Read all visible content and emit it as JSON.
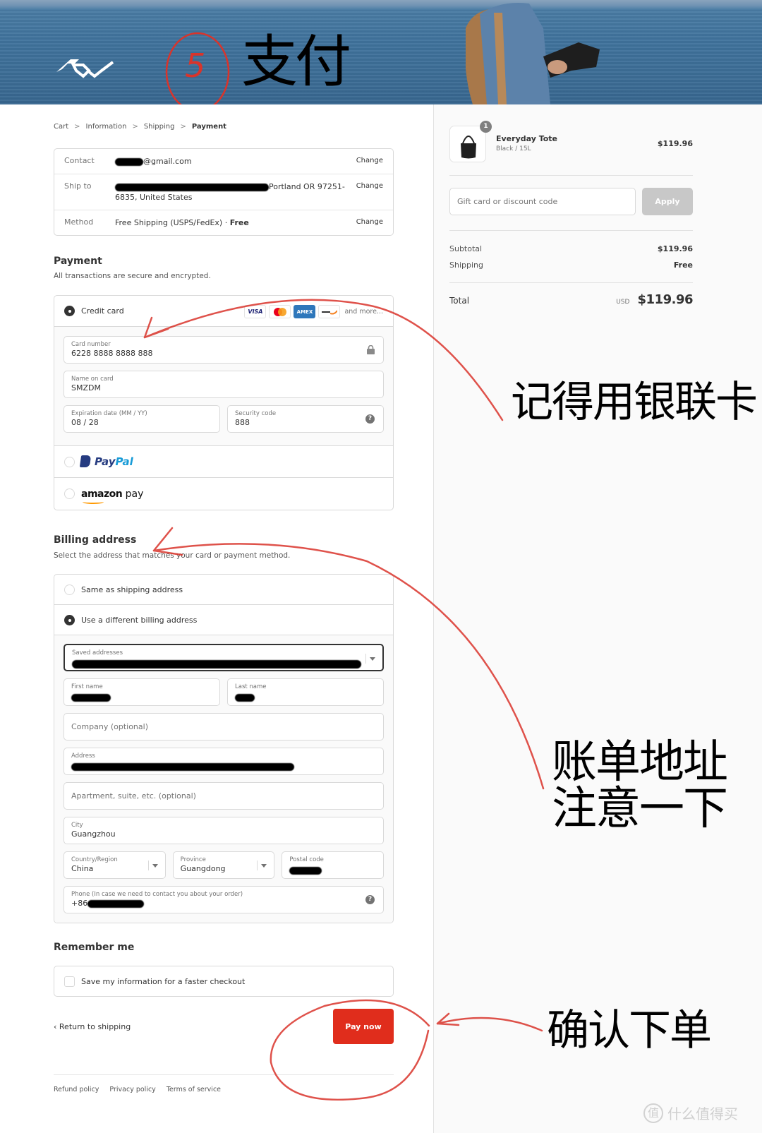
{
  "banner": {
    "brand_logo": "peak-design-logo",
    "annotation_step": "5",
    "annotation_title": "支付"
  },
  "breadcrumb": [
    {
      "label": "Cart"
    },
    {
      "label": "Information"
    },
    {
      "label": "Shipping"
    },
    {
      "label": "Payment",
      "current": true
    }
  ],
  "review": {
    "contact": {
      "label": "Contact",
      "value": "@gmail.com",
      "change": "Change"
    },
    "ship_to": {
      "label": "Ship to",
      "value": "Portland OR 97251-6835, United States",
      "change": "Change"
    },
    "method": {
      "label": "Method",
      "value": "Free Shipping (USPS/FedEx) · ",
      "value_bold": "Free",
      "change": "Change"
    }
  },
  "payment": {
    "title": "Payment",
    "subtitle": "All transactions are secure and encrypted.",
    "credit_card_label": "Credit card",
    "brands": [
      "VISA",
      "mastercard",
      "AMEX",
      "discover"
    ],
    "and_more": "and more...",
    "card_number": {
      "label": "Card number",
      "value": "6228 8888 8888 888"
    },
    "name_on_card": {
      "label": "Name on card",
      "value": "SMZDM"
    },
    "expiration": {
      "label": "Expiration date (MM / YY)",
      "value": "08 / 28"
    },
    "security_code": {
      "label": "Security code",
      "value": "888"
    },
    "paypal": {
      "pay": "Pay",
      "pal": "Pal"
    },
    "amazon": {
      "amazon": "amazon",
      "pay": "pay"
    }
  },
  "billing": {
    "title": "Billing address",
    "subtitle": "Select the address that matches your card or payment method.",
    "same_label": "Same as shipping address",
    "different_label": "Use a different billing address",
    "saved_addresses_label": "Saved addresses",
    "first_name_label": "First name",
    "last_name_label": "Last name",
    "company_placeholder": "Company (optional)",
    "address_label": "Address",
    "apartment_placeholder": "Apartment, suite, etc. (optional)",
    "city": {
      "label": "City",
      "value": "Guangzhou"
    },
    "country": {
      "label": "Country/Region",
      "value": "China"
    },
    "province": {
      "label": "Province",
      "value": "Guangdong"
    },
    "postal_label": "Postal code",
    "phone": {
      "label": "Phone (In case we need to contact you about your order)",
      "value": "+86"
    }
  },
  "remember": {
    "title": "Remember me",
    "save_label": "Save my information for a faster checkout"
  },
  "actions": {
    "return_label": "Return to shipping",
    "pay_now": "Pay now"
  },
  "footer": [
    "Refund policy",
    "Privacy policy",
    "Terms of service"
  ],
  "summary": {
    "item": {
      "name": "Everyday Tote",
      "variant": "Black / 15L",
      "price": "$119.96",
      "quantity": "1"
    },
    "discount_placeholder": "Gift card or discount code",
    "apply_label": "Apply",
    "subtotal_label": "Subtotal",
    "subtotal_value": "$119.96",
    "shipping_label": "Shipping",
    "shipping_value": "Free",
    "total_label": "Total",
    "currency": "USD",
    "total_value": "$119.96"
  },
  "annotations": {
    "union_pay_note": "记得用银联卡",
    "billing_note_1": "账单地址",
    "billing_note_2": "注意一下",
    "confirm_note": "确认下单",
    "watermark": "什么值得买",
    "watermark_badge": "值",
    "annotation_color": "#d9342b"
  },
  "colors": {
    "pay_button": "#e02d1c",
    "apply_button_disabled": "#c8c8c8",
    "sidebar_bg": "#fafafa"
  }
}
